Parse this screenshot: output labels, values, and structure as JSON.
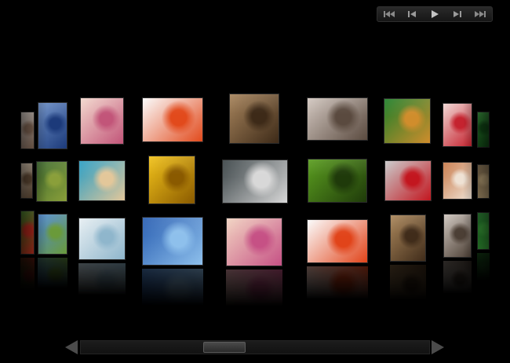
{
  "controls": [
    {
      "id": "first",
      "icon": "skip-to-first-icon"
    },
    {
      "id": "prev",
      "icon": "previous-icon"
    },
    {
      "id": "play",
      "icon": "play-icon"
    },
    {
      "id": "next",
      "icon": "next-icon"
    },
    {
      "id": "last",
      "icon": "skip-to-last-icon"
    }
  ],
  "wall": {
    "rows": 3,
    "columns": 10,
    "tiles": [
      {
        "name": "girl-chef-photo",
        "palette": [
          "#ddd3cc",
          "#8a6d5a"
        ]
      },
      {
        "name": "bird-sky-photo",
        "palette": [
          "#6c8fc7",
          "#1c3a7a"
        ]
      },
      {
        "name": "woman-orchid-photo",
        "palette": [
          "#f2d7cc",
          "#c25579"
        ]
      },
      {
        "name": "woman-gerbera-profile-photo",
        "palette": [
          "#fafafa",
          "#e24a1c"
        ]
      },
      {
        "name": "curly-hair-woman-photo",
        "palette": [
          "#a7845c",
          "#3d2a18"
        ]
      },
      {
        "name": "business-race-photo",
        "palette": [
          "#d2c7c0",
          "#5a4a3f"
        ]
      },
      {
        "name": "tree-frog-photo",
        "palette": [
          "#1f7f2a",
          "#d08d2c"
        ]
      },
      {
        "name": "party-woman-red-photo",
        "palette": [
          "#f0d5d2",
          "#c5232f"
        ]
      },
      {
        "name": "green-leaf-photo",
        "palette": [
          "#2b8a2f",
          "#114a16"
        ]
      },
      {
        "name": "salad-photo",
        "palette": [
          "#d9c7b0",
          "#6a513a"
        ]
      },
      {
        "name": "green-chair-room-photo",
        "palette": [
          "#3f6b2f",
          "#8a9f3a"
        ]
      },
      {
        "name": "beach-starfish-photo",
        "palette": [
          "#2b9ec4",
          "#e3c79a"
        ]
      },
      {
        "name": "sunflowers-photo",
        "palette": [
          "#f1c21a",
          "#8a5a00"
        ]
      },
      {
        "name": "teacher-chalkboard-photo",
        "palette": [
          "#3b4447",
          "#d8d8d8"
        ]
      },
      {
        "name": "green-kitchen-photo",
        "palette": [
          "#5a9d1f",
          "#1f3a0a"
        ]
      },
      {
        "name": "red-sports-car-photo",
        "palette": [
          "#c8c8c8",
          "#c3161f"
        ]
      },
      {
        "name": "party-table-photo",
        "palette": [
          "#c87a4a",
          "#efe2d4"
        ]
      },
      {
        "name": "dining-room-photo",
        "palette": [
          "#7f6848",
          "#c5ab7e"
        ]
      },
      {
        "name": "red-flower-field-photo",
        "palette": [
          "#3d7a1e",
          "#b82a1e"
        ]
      },
      {
        "name": "eiffel-tower-photo",
        "palette": [
          "#4f8ad2",
          "#6a9a3a"
        ]
      },
      {
        "name": "lab-scientists-photo",
        "palette": [
          "#e6eef2",
          "#8fb6cc"
        ]
      },
      {
        "name": "bird-sky-large-photo",
        "palette": [
          "#2a5fb2",
          "#8ec0ec"
        ]
      },
      {
        "name": "woman-orchid-large-photo",
        "palette": [
          "#f1d2c0",
          "#c65185"
        ]
      },
      {
        "name": "woman-gerbera-large-photo",
        "palette": [
          "#fbfbfb",
          "#e1441a"
        ]
      },
      {
        "name": "curly-hair-woman-large-photo",
        "palette": [
          "#ab875b",
          "#402c1a"
        ]
      },
      {
        "name": "business-race-large-photo",
        "palette": [
          "#cfc6be",
          "#4c3f35"
        ]
      },
      {
        "name": "tree-frog-large-photo",
        "palette": [
          "#1c7a26",
          "#3aa33a"
        ]
      }
    ]
  },
  "scroller": {
    "position": 0.4,
    "left_arrow": "scroll-left-arrow-icon",
    "right_arrow": "scroll-right-arrow-icon"
  }
}
